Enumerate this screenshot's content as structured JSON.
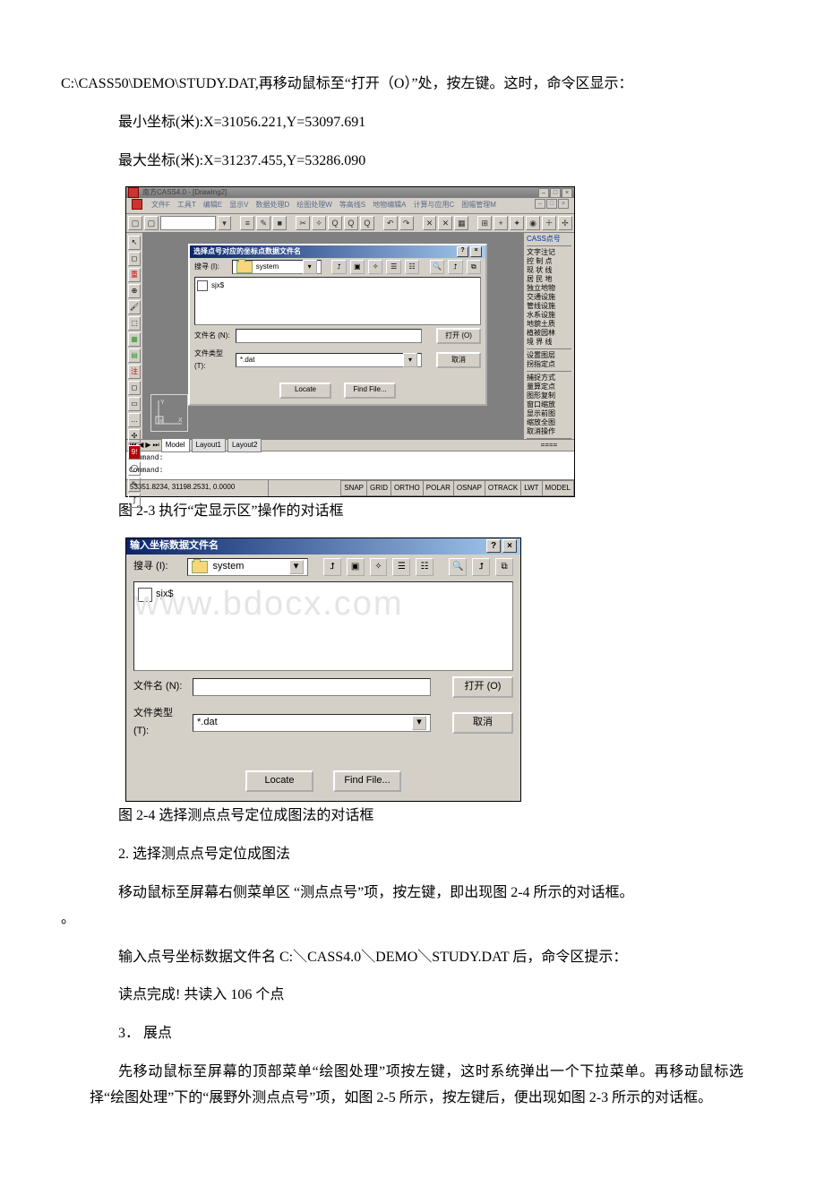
{
  "para": {
    "p1a": "C:\\CASS50\\DEMO\\STUDY.DAT,再移动鼠标至“打开（O）”处，按左键。这时，命令区显示：",
    "p2": "最小坐标(米):X=31056.221,Y=53097.691",
    "p3": "最大坐标(米):X=31237.455,Y=53286.090",
    "cap1": "图 2-3 执行“定显示区”操作的对话框",
    "cap2": "图 2-4 选择测点点号定位成图法的对话框",
    "p4": "2.  选择测点点号定位成图法",
    "p5": "移动鼠标至屏幕右侧菜单区 “测点点号”项，按左键，即出现图 2-4 所示的对话框。",
    "p5tail": "。",
    "p6": "输入点号坐标数据文件名 C:＼CASS4.0＼DEMO＼STUDY.DAT 后，命令区提示：",
    "p7": "读点完成! 共读入 106 个点",
    "p8": "3．  展点",
    "p9": "先移动鼠标至屏幕的顶部菜单“绘图处理”项按左键，这时系统弹出一个下拉菜单。再移动鼠标选择“绘图处理”下的“展野外测点点号”项，如图 2-5 所示，按左键后，便出现如图 2-3 所示的对话框。"
  },
  "cad": {
    "title": "南方CASS4.0 - [Drawing2]",
    "menus": [
      "文件F",
      "工具T",
      "编辑E",
      "显示V",
      "数据处理D",
      "绘图处理W",
      "等高线S",
      "地物编辑A",
      "计算与应用C",
      "图幅管理M"
    ],
    "rpanel_head": "CASS点号",
    "rpanel_items": [
      "文字注记",
      "控 制 点",
      "现 状 线",
      "居 民 地",
      "独立地物",
      "交通设施",
      "管线设施",
      "水系设施",
      "地貌土质",
      "植被园林",
      "境 界 线"
    ],
    "rpanel_items2": [
      "设置图层",
      "拐指定点",
      "捕捉方式",
      "量算定点",
      "图形复制",
      "窗口缩放",
      "显示前图",
      "缩放全图",
      "取消操作"
    ],
    "tabs": {
      "model": "Model",
      "layout1": "Layout1",
      "layout2": "Layout2"
    },
    "cmd1": "Command:",
    "cmd2": "Command:",
    "coord": "53351.8234, 31198.2531, 0.0000",
    "modes": [
      "SNAP",
      "GRID",
      "ORTHO",
      "POLAR",
      "OSNAP",
      "OTRACK",
      "LWT",
      "MODEL"
    ]
  },
  "dlg1": {
    "title": "选择点号对应的坐标点数据文件名",
    "lookin_label": "搜寻 (I):",
    "lookin_value": "system",
    "file_item": "sjx$",
    "fn_label": "文件名 (N):",
    "fn_value": "",
    "ft_label": "文件类型 (T):",
    "ft_value": "*.dat",
    "open": "打开 (O)",
    "cancel": "取消",
    "locate": "Locate",
    "findfile": "Find File..."
  },
  "dlg2": {
    "title": "输入坐标数据文件名",
    "lookin_label": "搜寻 (I):",
    "lookin_value": "system",
    "file_item": "sjx$",
    "fn_label": "文件名 (N):",
    "fn_value": "",
    "ft_label": "文件类型 (T):",
    "ft_value": "*.dat",
    "open": "打开 (O)",
    "cancel": "取消",
    "locate": "Locate",
    "findfile": "Find File..."
  },
  "watermark": "www.bdocx.com"
}
